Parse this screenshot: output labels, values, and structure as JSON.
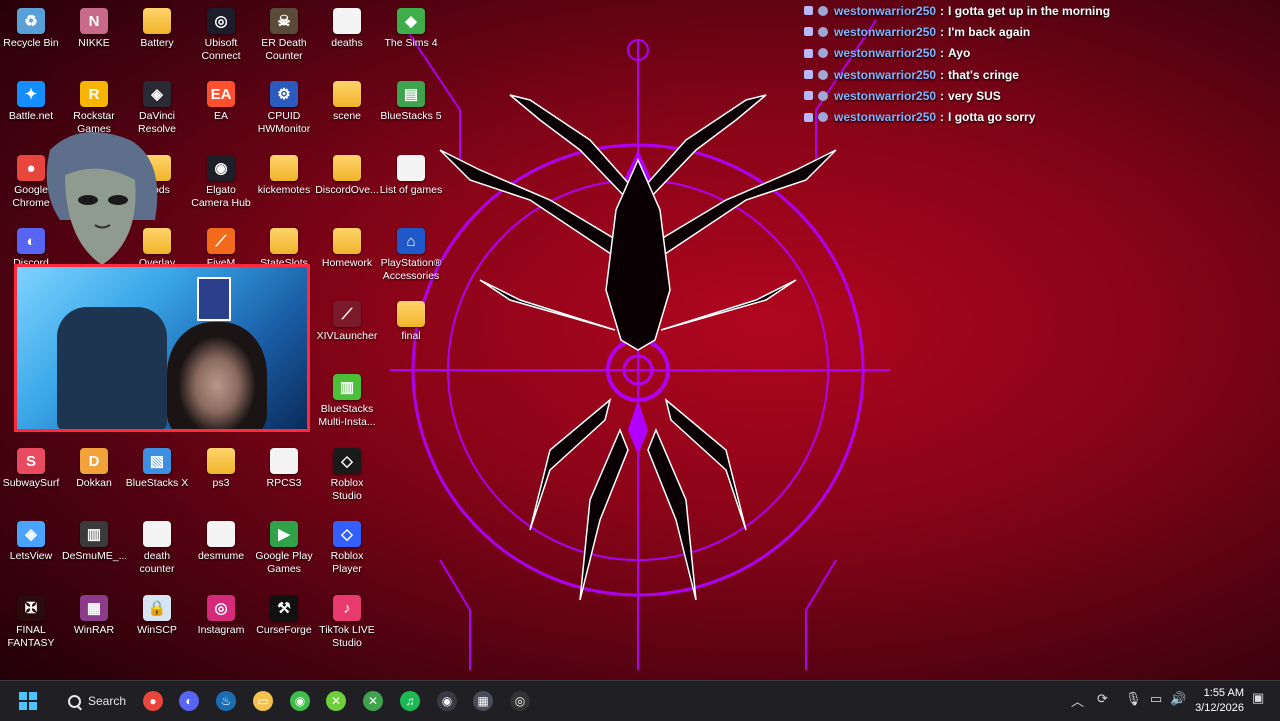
{
  "desktop": {
    "icons": [
      {
        "label": "Recycle Bin",
        "icon": "recycle-bin-icon",
        "color": "#5aa0d8",
        "glyph": "♻",
        "style": ""
      },
      {
        "label": "NIKKE",
        "icon": "nikke-icon",
        "color": "#c86a8a",
        "glyph": "N",
        "style": ""
      },
      {
        "label": "Battery",
        "icon": "folder-icon",
        "color": "",
        "glyph": "",
        "style": "folder"
      },
      {
        "label": "Ubisoft Connect",
        "icon": "ubisoft-icon",
        "color": "#1c1c2a",
        "glyph": "◎",
        "style": ""
      },
      {
        "label": "ER Death Counter",
        "icon": "er-death-counter-icon",
        "color": "#5a4a3a",
        "glyph": "☠",
        "style": ""
      },
      {
        "label": "deaths",
        "icon": "file-icon",
        "color": "",
        "glyph": "",
        "style": "file"
      },
      {
        "label": "The Sims 4",
        "icon": "sims-icon",
        "color": "#3fae4a",
        "glyph": "◆",
        "style": ""
      },
      {
        "label": "Battle.net",
        "icon": "battlenet-icon",
        "color": "#148eff",
        "glyph": "✦",
        "style": ""
      },
      {
        "label": "Rockstar Games",
        "icon": "rockstar-icon",
        "color": "#f7b500",
        "glyph": "R",
        "style": ""
      },
      {
        "label": "DaVinci Resolve",
        "icon": "davinci-icon",
        "color": "#2a2a34",
        "glyph": "◈",
        "style": ""
      },
      {
        "label": "EA",
        "icon": "ea-icon",
        "color": "#ff4f2e",
        "glyph": "EA",
        "style": ""
      },
      {
        "label": "CPUID HWMonitor",
        "icon": "hwmonitor-icon",
        "color": "#2b5bbf",
        "glyph": "⚙",
        "style": ""
      },
      {
        "label": "scene",
        "icon": "folder-icon",
        "color": "",
        "glyph": "",
        "style": "folder"
      },
      {
        "label": "BlueStacks 5",
        "icon": "bluestacks-icon",
        "color": "#3fa34d",
        "glyph": "▤",
        "style": ""
      },
      {
        "label": "Google Chrome",
        "icon": "chrome-icon",
        "color": "#e8453c",
        "glyph": "●",
        "style": ""
      },
      {
        "label": "mods",
        "icon": "folder-icon",
        "color": "",
        "glyph": "",
        "style": "folder"
      },
      {
        "label": "Elgato Camera Hub",
        "icon": "elgato-icon",
        "color": "#1e1e26",
        "glyph": "◉",
        "style": ""
      },
      {
        "label": "kickemotes",
        "icon": "folder-icon",
        "color": "",
        "glyph": "",
        "style": "folder"
      },
      {
        "label": "DiscordOve...",
        "icon": "folder-icon",
        "color": "",
        "glyph": "",
        "style": "folder"
      },
      {
        "label": "List of games",
        "icon": "file-icon",
        "color": "",
        "glyph": "",
        "style": "file"
      },
      {
        "label": "Discord",
        "icon": "discord-icon",
        "color": "#5865f2",
        "glyph": "◐",
        "style": ""
      },
      {
        "label": "Overlay",
        "icon": "folder-icon",
        "color": "",
        "glyph": "",
        "style": "folder"
      },
      {
        "label": "FiveM",
        "icon": "fivem-icon",
        "color": "#f26b1d",
        "glyph": "⟋",
        "style": ""
      },
      {
        "label": "StateSlots",
        "icon": "folder-icon",
        "color": "",
        "glyph": "",
        "style": "folder"
      },
      {
        "label": "Homework",
        "icon": "folder-icon",
        "color": "",
        "glyph": "",
        "style": "folder"
      },
      {
        "label": "PlayStation® Accessories",
        "icon": "playstation-icon",
        "color": "#1f58c9",
        "glyph": "⌂",
        "style": ""
      },
      {
        "label": "XIVLauncher",
        "icon": "xivlauncher-icon",
        "color": "#7a1a2a",
        "glyph": "⟋",
        "style": ""
      },
      {
        "label": "final",
        "icon": "folder-icon",
        "color": "",
        "glyph": "",
        "style": "folder"
      },
      {
        "label": "BlueStacks Multi-Insta...",
        "icon": "bluestacks-multi-icon",
        "color": "#4bbf3a",
        "glyph": "▥",
        "style": ""
      },
      {
        "label": "SubwaySurf",
        "icon": "subwaysurf-icon",
        "color": "#e84a5f",
        "glyph": "S",
        "style": ""
      },
      {
        "label": "Dokkan",
        "icon": "dokkan-icon",
        "color": "#f2a23b",
        "glyph": "D",
        "style": ""
      },
      {
        "label": "BlueStacks X",
        "icon": "bluestacks-x-icon",
        "color": "#3f8fe0",
        "glyph": "▧",
        "style": ""
      },
      {
        "label": "ps3",
        "icon": "folder-icon",
        "color": "",
        "glyph": "",
        "style": "folder"
      },
      {
        "label": "RPCS3",
        "icon": "file-icon",
        "color": "",
        "glyph": "",
        "style": "file"
      },
      {
        "label": "Roblox Studio",
        "icon": "roblox-studio-icon",
        "color": "#1a1a1a",
        "glyph": "◇",
        "style": ""
      },
      {
        "label": "LetsView",
        "icon": "letsview-icon",
        "color": "#4aa3ff",
        "glyph": "◈",
        "style": ""
      },
      {
        "label": "DeSmuME_...",
        "icon": "desmume-icon",
        "color": "#3a3a3a",
        "glyph": "▥",
        "style": ""
      },
      {
        "label": "death counter",
        "icon": "file-icon",
        "color": "",
        "glyph": "",
        "style": "file"
      },
      {
        "label": "desmume",
        "icon": "file-icon",
        "color": "",
        "glyph": "",
        "style": "file"
      },
      {
        "label": "Google Play Games",
        "icon": "google-play-games-icon",
        "color": "#2fa24a",
        "glyph": "▶",
        "style": ""
      },
      {
        "label": "Roblox Player",
        "icon": "roblox-player-icon",
        "color": "#335fff",
        "glyph": "◇",
        "style": ""
      },
      {
        "label": "FINAL FANTASY XI...",
        "icon": "ffxiv-icon",
        "color": "#2a0a0a",
        "glyph": "✠",
        "style": ""
      },
      {
        "label": "WinRAR",
        "icon": "winrar-icon",
        "color": "#8a3b8a",
        "glyph": "▦",
        "style": ""
      },
      {
        "label": "WinSCP",
        "icon": "winscp-icon",
        "color": "#d8e4f0",
        "glyph": "🔒",
        "style": ""
      },
      {
        "label": "Instagram",
        "icon": "instagram-icon",
        "color": "#d6297a",
        "glyph": "◎",
        "style": ""
      },
      {
        "label": "CurseForge",
        "icon": "curseforge-icon",
        "color": "#111111",
        "glyph": "⚒",
        "style": ""
      },
      {
        "label": "TikTok LIVE Studio",
        "icon": "tiktok-live-icon",
        "color": "#e83a6d",
        "glyph": "♪",
        "style": ""
      }
    ]
  },
  "chat": {
    "messages": [
      {
        "user": "westonwarrior250",
        "separator": ":",
        "text": "I gotta get up in the morning"
      },
      {
        "user": "westonwarrior250",
        "separator": ":",
        "text": "I'm back again"
      },
      {
        "user": "westonwarrior250",
        "separator": ":",
        "text": "Ayo"
      },
      {
        "user": "westonwarrior250",
        "separator": ":",
        "text": "that's cringe"
      },
      {
        "user": "westonwarrior250",
        "separator": ":",
        "text": "very SUS"
      },
      {
        "user": "westonwarrior250",
        "separator": ":",
        "text": "I gotta go sorry"
      }
    ]
  },
  "taskbar": {
    "search_label": "Search",
    "apps": [
      {
        "name": "chrome-taskbar-icon",
        "glyph": "●",
        "color": "#e8453c"
      },
      {
        "name": "discord-taskbar-icon",
        "glyph": "◐",
        "color": "#5865f2"
      },
      {
        "name": "steam-taskbar-icon",
        "glyph": "♨",
        "color": "#1b6db3"
      },
      {
        "name": "file-explorer-taskbar-icon",
        "glyph": "▭",
        "color": "#f2c14e"
      },
      {
        "name": "geforce-taskbar-icon",
        "glyph": "◉",
        "color": "#3fbf4a"
      },
      {
        "name": "xbox-app-taskbar-icon",
        "glyph": "✕",
        "color": "#6fcf3a"
      },
      {
        "name": "xbox-taskbar-icon",
        "glyph": "✕",
        "color": "#3fa34d"
      },
      {
        "name": "spotify-taskbar-icon",
        "glyph": "♫",
        "color": "#1db954"
      },
      {
        "name": "elgato-taskbar-icon",
        "glyph": "◉",
        "color": "#3a3a44"
      },
      {
        "name": "calculator-taskbar-icon",
        "glyph": "▦",
        "color": "#4a4a58"
      },
      {
        "name": "obs-taskbar-icon",
        "glyph": "◎",
        "color": "#333"
      }
    ],
    "tray": {
      "chevron": "︿",
      "time": "1:55 AM",
      "date": "3/12/2026"
    }
  },
  "colors": {
    "accent_purple": "#b000ff",
    "chat_username": "#7fb4ff",
    "webcam_border": "#ff2a3d"
  }
}
